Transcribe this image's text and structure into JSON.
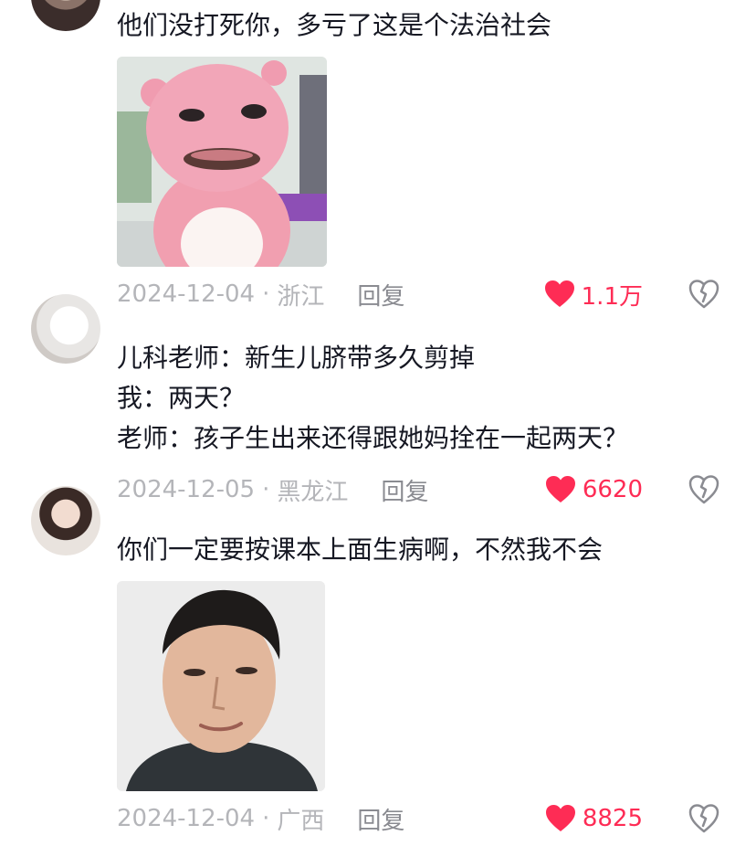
{
  "comments": [
    {
      "text": "他们没打死你，多亏了这是个法治社会",
      "date": "2024-12-04",
      "location": "浙江",
      "reply_label": "回复",
      "likes": "1.1万"
    },
    {
      "text": "儿科老师：新生儿脐带多久剪掉\n我：两天？\n老师：孩子生出来还得跟她妈拴在一起两天？",
      "date": "2024-12-05",
      "location": "黑龙江",
      "reply_label": "回复",
      "likes": "6620"
    },
    {
      "text": "你们一定要按课本上面生病啊，不然我不会",
      "date": "2024-12-04",
      "location": "广西",
      "reply_label": "回复",
      "likes": "8825"
    }
  ],
  "meta_separator": "·",
  "colors": {
    "like": "#fe2c55",
    "meta": "#b4b5b9",
    "text": "#161823"
  }
}
